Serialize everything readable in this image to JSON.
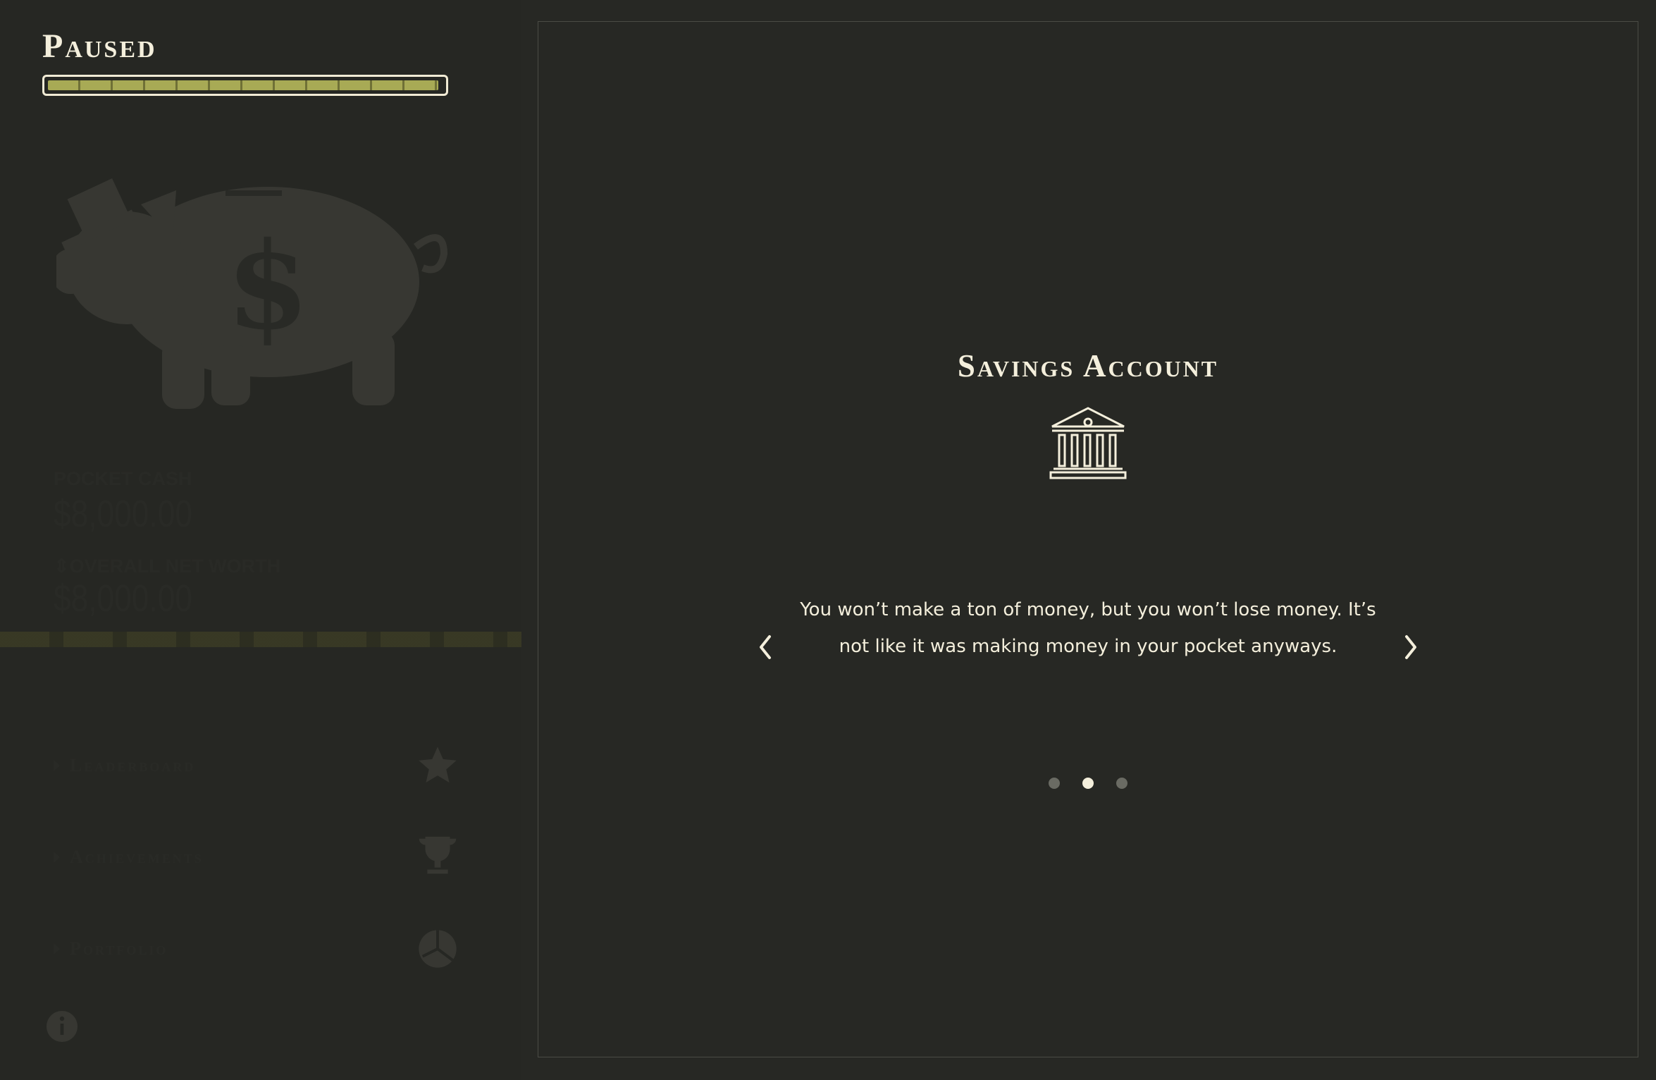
{
  "status": {
    "title": "Paused",
    "progress_percent": 99
  },
  "sidebar": {
    "stats": [
      {
        "label": "POCKET CASH",
        "value": "$8,000.00"
      },
      {
        "label": "OVERALL NET WORTH",
        "value": "$8,000.00"
      }
    ],
    "menu": [
      {
        "label": "Leaderboard",
        "icon": "star-icon"
      },
      {
        "label": "Achievements",
        "icon": "trophy-icon"
      },
      {
        "label": "Portfolio",
        "icon": "pie-chart-icon"
      }
    ],
    "info_icon": "info-icon"
  },
  "card": {
    "title": "Savings Account",
    "icon": "bank-icon",
    "body": "You won’t make a ton of money, but you won’t lose money. It’s not like it was making money in your pocket anyways.",
    "pagination": {
      "total": 3,
      "active_index": 1
    }
  },
  "colors": {
    "background": "#272824",
    "text": "#f4efdc",
    "accent": "#a8aa55"
  }
}
